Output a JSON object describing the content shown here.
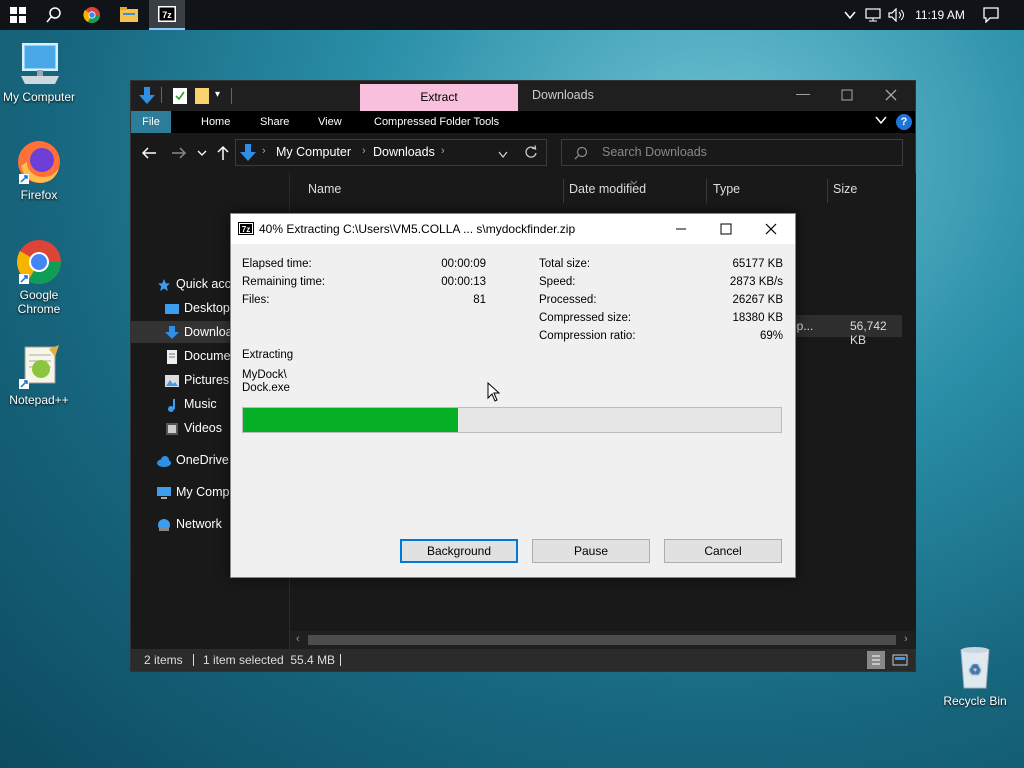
{
  "taskbar": {
    "time": "11:19 AM"
  },
  "desktop": {
    "icons": [
      {
        "label": "My Computer"
      },
      {
        "label": "Firefox"
      },
      {
        "label": "Google Chrome"
      },
      {
        "label": "Notepad++"
      },
      {
        "label": "Recycle Bin"
      }
    ]
  },
  "explorer": {
    "title": "Downloads",
    "context_tab": "Extract",
    "ribbon_tabs": [
      "File",
      "Home",
      "Share",
      "View",
      "Compressed Folder Tools"
    ],
    "breadcrumb": [
      "My Computer",
      "Downloads"
    ],
    "search_placeholder": "Search Downloads",
    "nav": [
      "Quick access",
      "Desktop",
      "Downloads",
      "Documents",
      "Pictures",
      "Music",
      "Videos",
      "OneDrive",
      "My Computer",
      "Network"
    ],
    "columns": [
      "Name",
      "Date modified",
      "Type",
      "Size"
    ],
    "row": {
      "type_partial": "op...",
      "size": "56,742 KB"
    },
    "status": {
      "items": "2 items",
      "selected": "1 item selected  55.4 MB"
    }
  },
  "dialog": {
    "title": "40% Extracting C:\\Users\\VM5.COLLA ... s\\mydockfinder.zip",
    "left": [
      {
        "label": "Elapsed time:",
        "value": "00:00:09"
      },
      {
        "label": "Remaining time:",
        "value": "00:00:13"
      },
      {
        "label": "Files:",
        "value": "81"
      }
    ],
    "right": [
      {
        "label": "Total size:",
        "value": "65177 KB"
      },
      {
        "label": "Speed:",
        "value": "2873 KB/s"
      },
      {
        "label": "Processed:",
        "value": "26267 KB"
      },
      {
        "label": "Compressed size:",
        "value": "18380 KB"
      },
      {
        "label": "Compression ratio:",
        "value": "69%"
      }
    ],
    "operation": "Extracting",
    "current_path": "MyDock\\",
    "current_file": "Dock.exe",
    "progress": 0.4,
    "buttons": {
      "background": "Background",
      "pause": "Pause",
      "cancel": "Cancel"
    }
  },
  "colors": {
    "progress_fill": "#06b025",
    "context_tab": "#f8c0dc",
    "accent": "#0078d7"
  }
}
